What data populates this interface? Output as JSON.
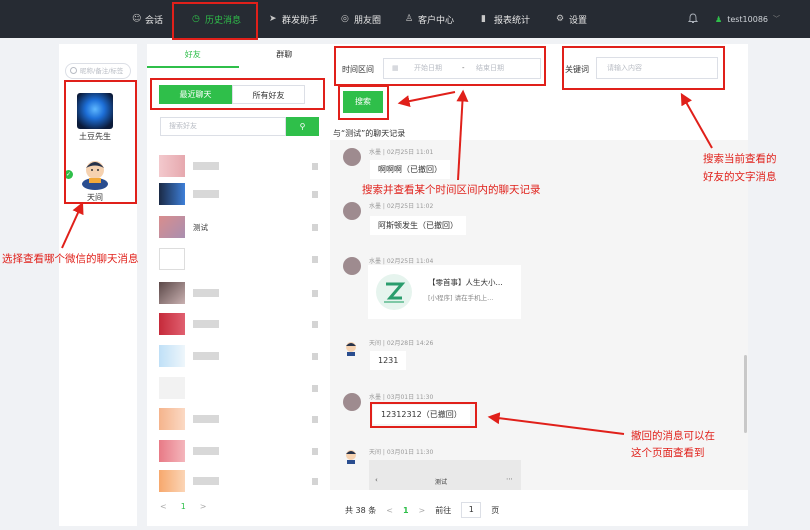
{
  "nav": {
    "items": [
      {
        "label": "会话",
        "icon": "chat-icon"
      },
      {
        "label": "历史消息",
        "icon": "clock-icon"
      },
      {
        "label": "群发助手",
        "icon": "send-icon"
      },
      {
        "label": "朋友圈",
        "icon": "moments-icon"
      },
      {
        "label": "客户中心",
        "icon": "user-icon"
      },
      {
        "label": "报表统计",
        "icon": "bar-chart-icon"
      },
      {
        "label": "设置",
        "icon": "gear-icon"
      }
    ],
    "active": "历史消息",
    "user": "test10086",
    "accent": "#2fbf4a"
  },
  "accounts": {
    "search_placeholder": "昵称/备注/标签",
    "items": [
      {
        "name": "土豆先生"
      },
      {
        "name": "天间",
        "selected": true
      }
    ]
  },
  "friends": {
    "tabs": [
      "好友",
      "群聊"
    ],
    "segments": [
      "最近聊天",
      "所有好友"
    ],
    "search_placeholder": "搜索好友",
    "list": [
      {
        "name": ""
      },
      {
        "name": ""
      },
      {
        "name": "测试"
      },
      {
        "name": ""
      },
      {
        "name": ""
      },
      {
        "name": ""
      },
      {
        "name": ""
      },
      {
        "name": ""
      },
      {
        "name": ""
      },
      {
        "name": ""
      },
      {
        "name": ""
      }
    ],
    "pager": {
      "prev": "<",
      "page": "1",
      "next": ">"
    }
  },
  "filter": {
    "date_label": "时间区间",
    "start_placeholder": "开始日期",
    "separator": "-",
    "end_placeholder": "结束日期",
    "keyword_label": "关键词",
    "keyword_placeholder": "请输入内容",
    "search_button": "搜索"
  },
  "history": {
    "title": "与“测试”的聊天记录",
    "messages": [
      {
        "meta": "水墨 | 02月25日 11:01",
        "text": "啊啊啊（已撤回）"
      },
      {
        "meta": "水墨 | 02月25日 11:02",
        "text": "阿斯顿发生（已撤回）"
      },
      {
        "meta": "水墨 | 02月25日 11:04",
        "card_title": "【零首事】人生大小...",
        "card_sub": "[小程序] 请在手机上..."
      },
      {
        "meta": "天间 | 02月28日 14:26",
        "text": "1231"
      },
      {
        "meta": "水墨 | 03月01日 11:30",
        "text": "12312312（已撤回）"
      },
      {
        "meta": "天间 | 03月01日 11:30",
        "text": "测试"
      }
    ],
    "pager": {
      "total": "共 38 条",
      "prev": "<",
      "page": "1",
      "next": ">",
      "goto_label": "前往",
      "goto_value": "1",
      "page_unit": "页"
    }
  },
  "annotations": {
    "select_wechat": "选择查看哪个微信的聊天消息",
    "search_range": "搜索并查看某个时间区间内的聊天记录",
    "search_friend_1": "搜索当前查看的",
    "search_friend_2": "好友的文字消息",
    "recall_1": "撤回的消息可以在",
    "recall_2": "这个页面查看到"
  }
}
